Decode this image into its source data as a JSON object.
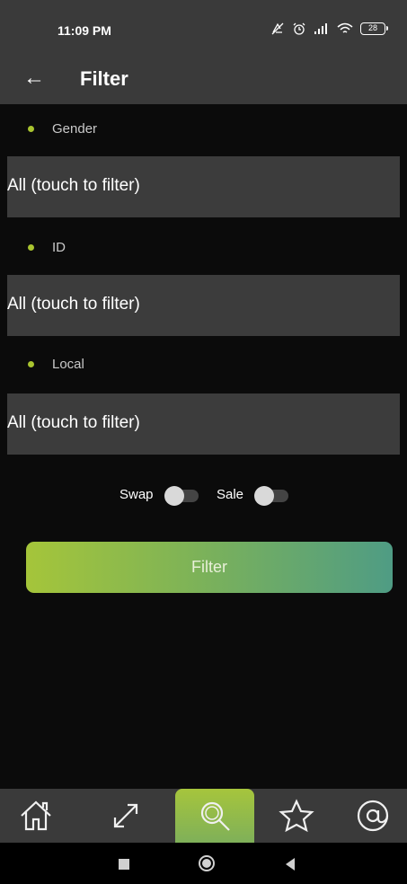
{
  "status_bar": {
    "time": "11:09 PM",
    "battery": "28"
  },
  "app_bar": {
    "title": "Filter"
  },
  "filters": [
    {
      "label": "Gender",
      "value": "All (touch to filter)"
    },
    {
      "label": "ID",
      "value": "All (touch to filter)"
    },
    {
      "label": "Local",
      "value": "All (touch to filter)"
    }
  ],
  "toggles": [
    {
      "label": "Swap",
      "on": false
    },
    {
      "label": "Sale",
      "on": false
    }
  ],
  "filter_button": {
    "label": "Filter"
  },
  "bottom_nav": {
    "items": [
      {
        "icon": "home-icon",
        "active": false
      },
      {
        "icon": "expand-arrows-icon",
        "active": false
      },
      {
        "icon": "search-icon",
        "active": true
      },
      {
        "icon": "star-icon",
        "active": false
      },
      {
        "icon": "at-sign-icon",
        "active": false
      }
    ]
  },
  "colors": {
    "accent": "#a9c42f",
    "gradient_start": "#a5c53a",
    "gradient_end": "#4f9c84",
    "surface": "#3a3a3a"
  }
}
